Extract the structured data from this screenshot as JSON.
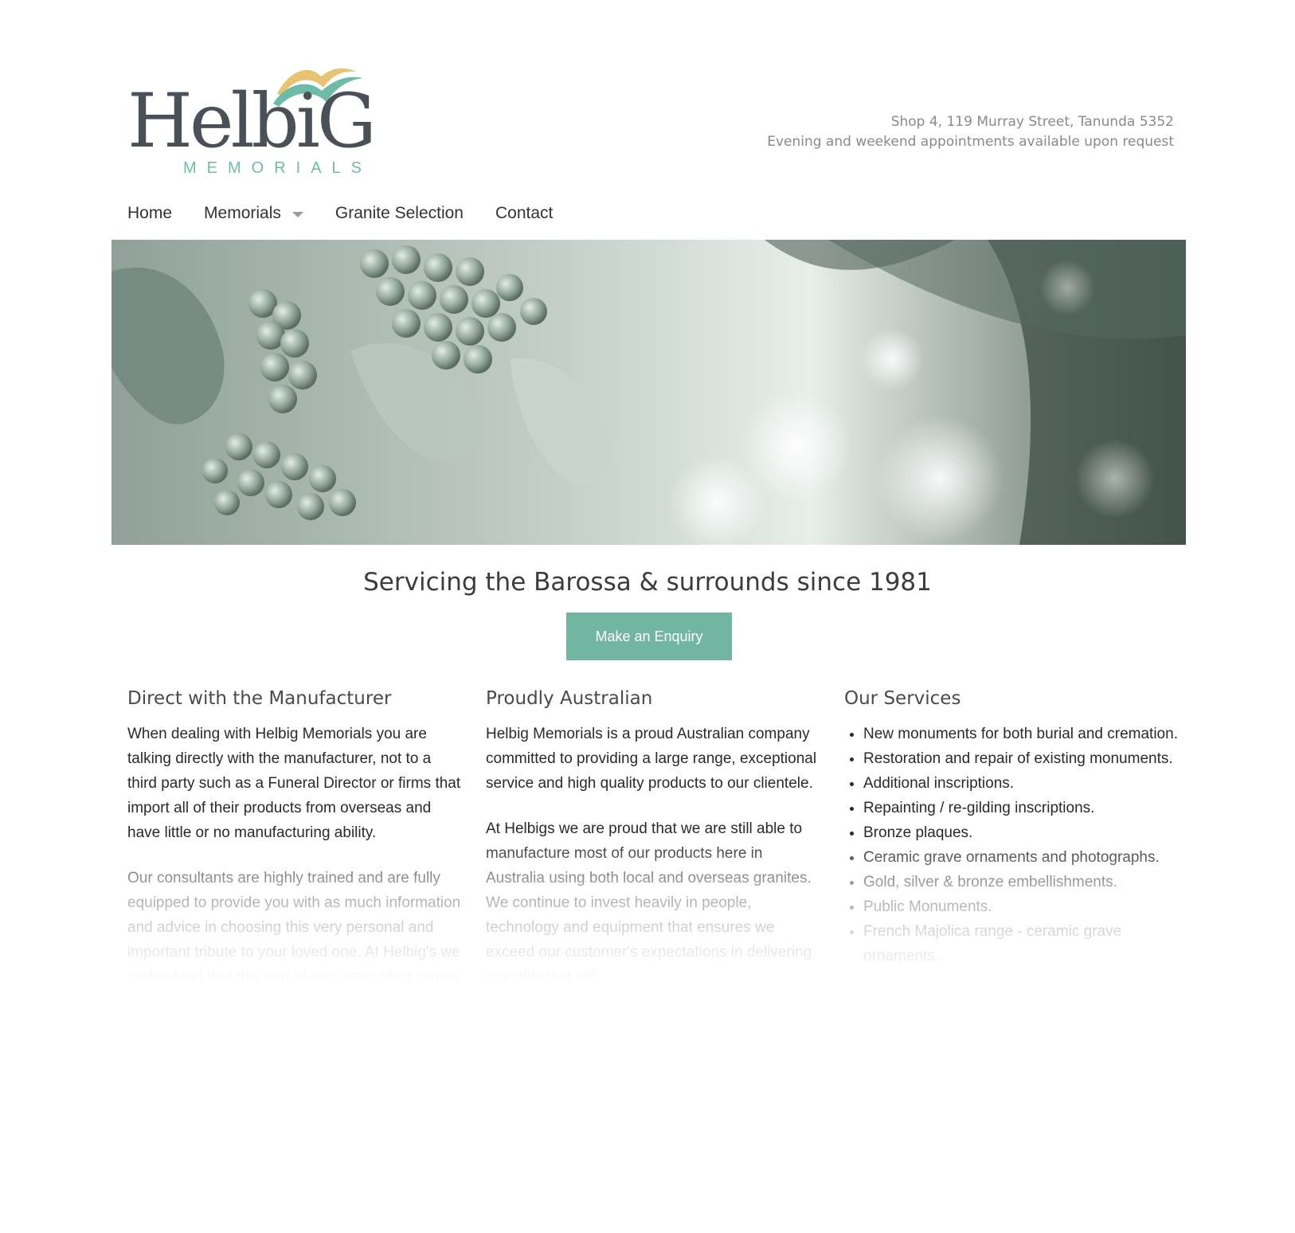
{
  "brand": {
    "name": "HelbiG",
    "tagline_sub": "MEMORIALS",
    "colors": {
      "accent": "#72b6a1",
      "logo_gray": "#4a5057",
      "logo_gold": "#e8c374",
      "logo_teal": "#6ebca7"
    }
  },
  "header": {
    "address": "Shop 4, 119 Murray Street, Tanunda 5352",
    "appointments": "Evening and weekend appointments available upon request"
  },
  "nav": {
    "items": [
      {
        "label": "Home"
      },
      {
        "label": "Memorials",
        "icon": "chevron-down-icon"
      },
      {
        "label": "Granite Selection"
      },
      {
        "label": "Contact"
      }
    ]
  },
  "hero": {
    "icon": "vineyard-grapes-image"
  },
  "main": {
    "headline": "Servicing the Barossa & surrounds since 1981",
    "cta_label": "Make an Enquiry"
  },
  "columns": [
    {
      "title": "Direct with the Manufacturer",
      "paragraphs": [
        "When dealing with Helbig Memorials you are talking directly with the manufacturer, not to a third party such as a Funeral Director or firms that import all of their products from overseas and have little or no manufacturing ability.",
        "Our consultants are highly trained and are fully equipped to provide you with as much information and advice in choosing this very personal and important tribute to your loved one. At Helbig's we understand that this sort of purchase often comes at a difficult time and"
      ]
    },
    {
      "title": "Proudly Australian",
      "paragraphs": [
        "Helbig Memorials is a proud Australian company committed to providing a large range, exceptional service and high quality products to our clientele.",
        "At Helbigs we are proud that we are still able to manufacture most of our products here in Australia using both local and overseas granites. We continue to invest heavily in people, technology and equipment that ensures we exceed our customer's expectations in delivering a quality that will"
      ]
    },
    {
      "title": "Our Services",
      "items": [
        "New monuments for both burial and cremation.",
        "Restoration and repair of existing monuments.",
        "Additional inscriptions.",
        "Repainting / re-gilding inscriptions.",
        "Bronze plaques.",
        "Ceramic grave ornaments and photographs.",
        "Gold, silver & bronze embellishments.",
        "Public Monuments.",
        "French Majolica range - ceramic grave ornaments."
      ]
    }
  ]
}
